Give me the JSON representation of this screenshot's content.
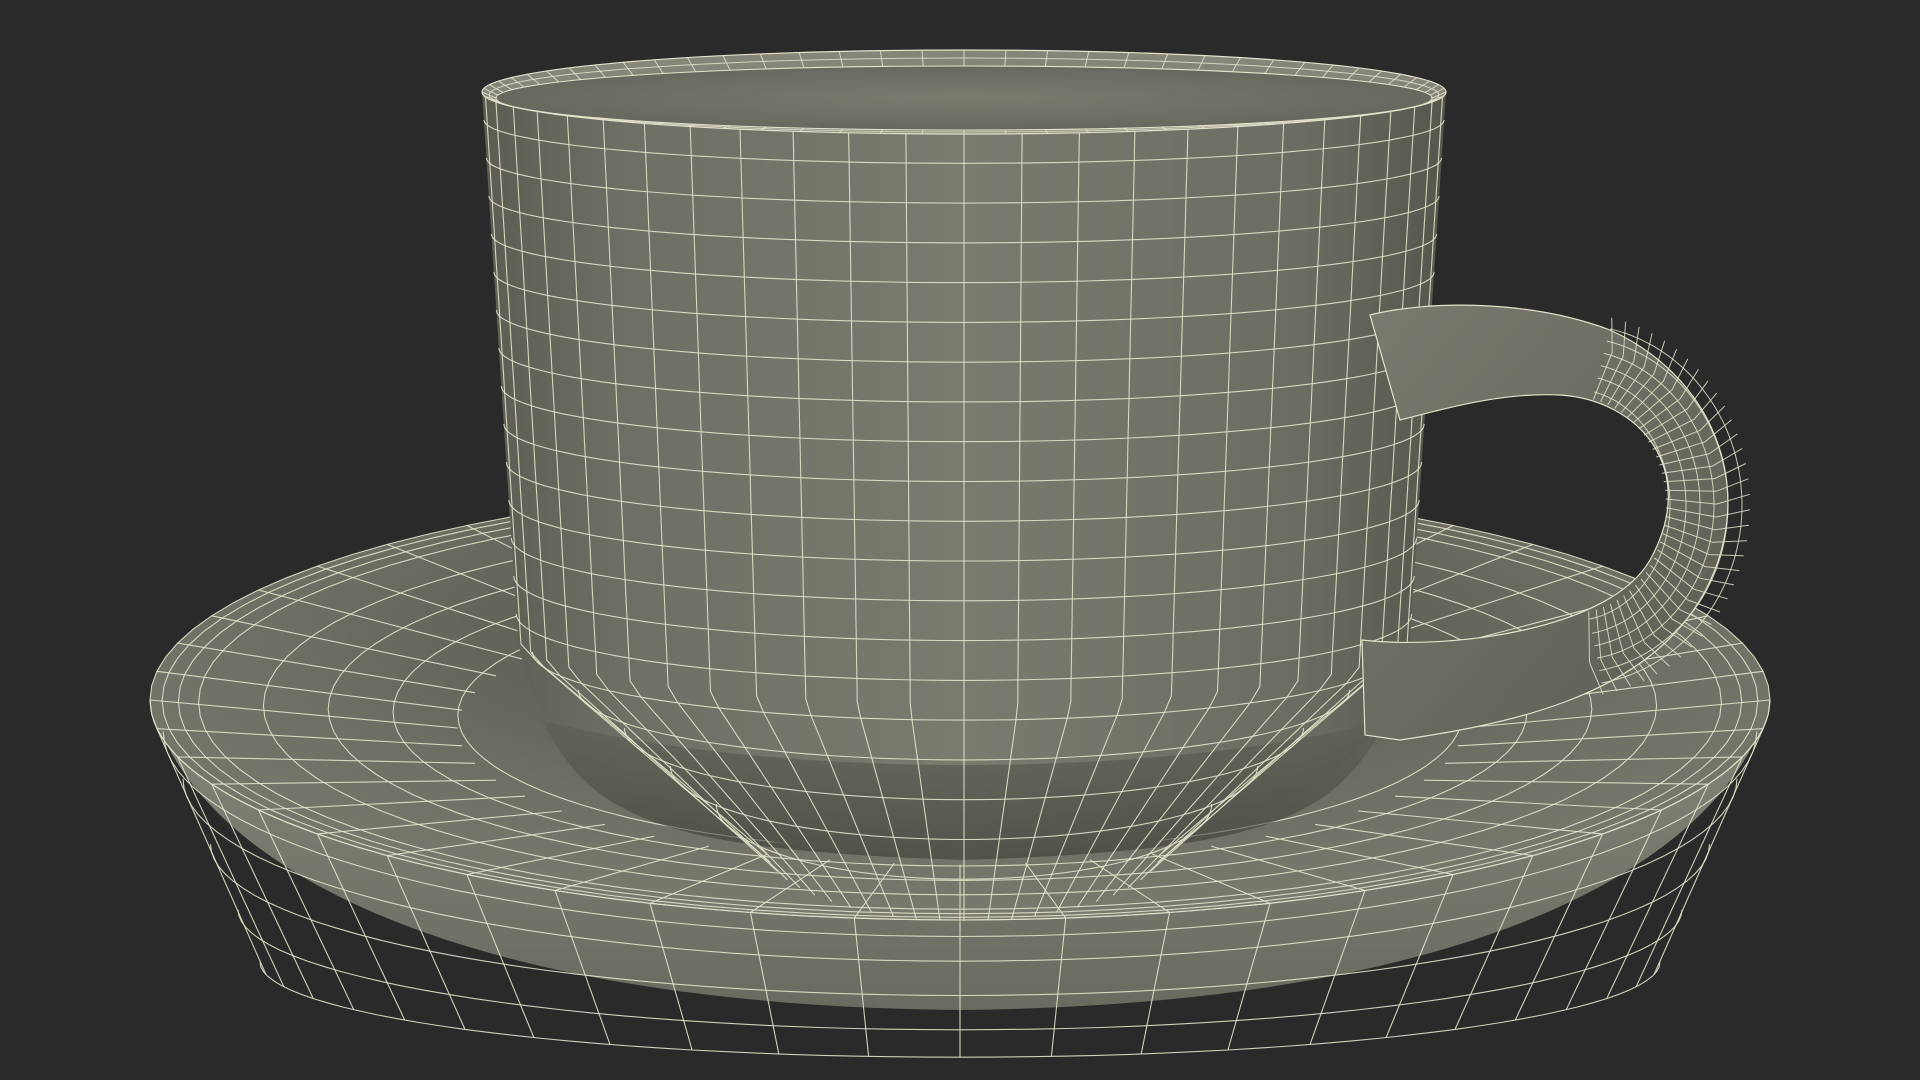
{
  "scene": {
    "subject": "cup-and-saucer",
    "render_style": "wireframe-over-shaded",
    "colors": {
      "background": "#2a2a2a",
      "surface": "#717166",
      "surface_dark": "#4a4a42",
      "surface_shadow": "#3a3a34",
      "wire": "#e4e2ca"
    }
  }
}
